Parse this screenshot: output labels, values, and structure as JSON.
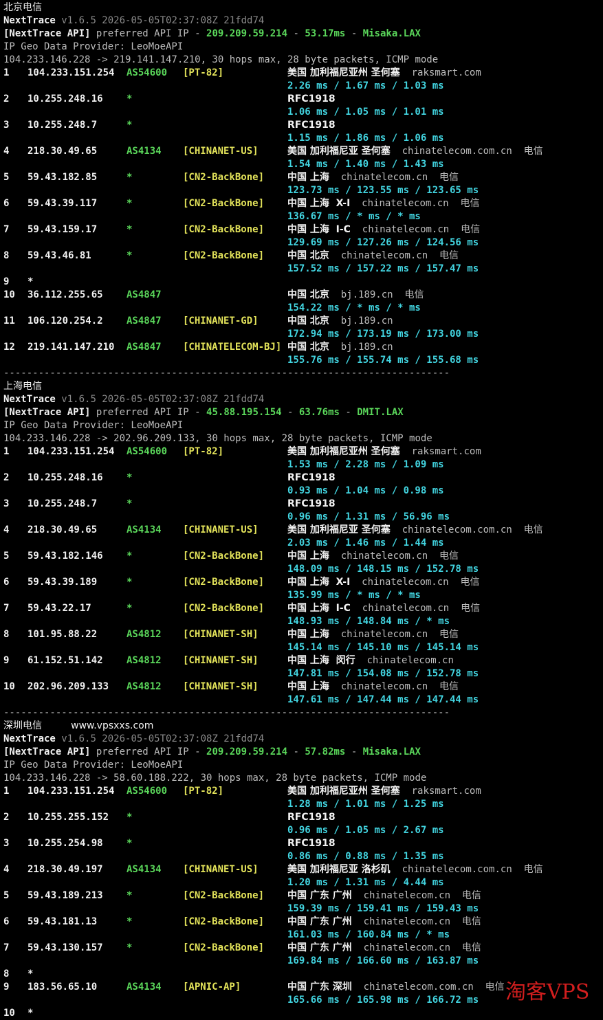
{
  "sections": [
    {
      "title": "北京电信",
      "site_label": "",
      "header": {
        "app": "NextTrace",
        "version": "v1.6.5 2026-05-05T02:37:08Z 21fdd74",
        "api_prefix": "[NextTrace API]",
        "api_text": "preferred API IP -",
        "api_ip": "209.209.59.214",
        "api_dash": "-",
        "api_latency": "53.17ms",
        "api_dash2": "-",
        "api_node": "Misaka.LAX",
        "geo_provider": "IP Geo Data Provider: LeoMoeAPI",
        "route": "104.233.146.228 -> 219.141.147.210, 30 hops max, 28 byte packets, ICMP mode"
      },
      "hops": [
        {
          "n": "1",
          "ip": "104.233.151.254",
          "asn": "AS54600",
          "tag": "[PT-82]",
          "geo": "美国 加利福尼亚州 圣何塞",
          "dom": "raksmart.com",
          "isp": "",
          "rtt": "2.26 ms / 1.67 ms / 1.03 ms"
        },
        {
          "n": "2",
          "ip": "10.255.248.16",
          "asn": "*",
          "tag": "",
          "geo": "RFC1918",
          "dom": "",
          "isp": "",
          "rtt": "1.06 ms / 1.05 ms / 1.01 ms"
        },
        {
          "n": "3",
          "ip": "10.255.248.7",
          "asn": "*",
          "tag": "",
          "geo": "RFC1918",
          "dom": "",
          "isp": "",
          "rtt": "1.15 ms / 1.86 ms / 1.06 ms"
        },
        {
          "n": "4",
          "ip": "218.30.49.65",
          "asn": "AS4134",
          "tag": "[CHINANET-US]",
          "geo": "美国 加利福尼亚 圣何塞",
          "dom": "chinatelecom.com.cn",
          "isp": "电信",
          "rtt": "1.54 ms / 1.40 ms / 1.43 ms"
        },
        {
          "n": "5",
          "ip": "59.43.182.85",
          "asn": "*",
          "tag": "[CN2-BackBone]",
          "geo": "中国 上海",
          "dom": "chinatelecom.cn",
          "isp": "电信",
          "rtt": "123.73 ms / 123.55 ms / 123.65 ms"
        },
        {
          "n": "6",
          "ip": "59.43.39.117",
          "asn": "*",
          "tag": "[CN2-BackBone]",
          "geo": "中国 上海  X-I",
          "dom": "chinatelecom.cn",
          "isp": "电信",
          "rtt": "136.67 ms / * ms / * ms"
        },
        {
          "n": "7",
          "ip": "59.43.159.17",
          "asn": "*",
          "tag": "[CN2-BackBone]",
          "geo": "中国 上海  I-C",
          "dom": "chinatelecom.cn",
          "isp": "电信",
          "rtt": "129.69 ms / 127.26 ms / 124.56 ms"
        },
        {
          "n": "8",
          "ip": "59.43.46.81",
          "asn": "*",
          "tag": "[CN2-BackBone]",
          "geo": "中国 北京",
          "dom": "chinatelecom.cn",
          "isp": "电信",
          "rtt": "157.52 ms / 157.22 ms / 157.47 ms"
        },
        {
          "n": "9",
          "ip": "*",
          "asn": "",
          "tag": "",
          "geo": "",
          "dom": "",
          "isp": "",
          "rtt": ""
        },
        {
          "n": "10",
          "ip": "36.112.255.65",
          "asn": "AS4847",
          "tag": "",
          "geo": "中国 北京",
          "dom": "bj.189.cn",
          "isp": "电信",
          "rtt": "154.22 ms / * ms / * ms"
        },
        {
          "n": "11",
          "ip": "106.120.254.2",
          "asn": "AS4847",
          "tag": "[CHINANET-GD]",
          "geo": "中国 北京",
          "dom": "bj.189.cn",
          "isp": "",
          "rtt": "172.94 ms / 173.19 ms / 173.00 ms"
        },
        {
          "n": "12",
          "ip": "219.141.147.210",
          "asn": "AS4847",
          "tag": "[CHINATELECOM-BJ]",
          "geo": "中国 北京",
          "dom": "bj.189.cn",
          "isp": "",
          "rtt": "155.76 ms / 155.74 ms / 155.68 ms"
        }
      ]
    },
    {
      "title": "上海电信",
      "site_label": "",
      "header": {
        "app": "NextTrace",
        "version": "v1.6.5 2026-05-05T02:37:08Z 21fdd74",
        "api_prefix": "[NextTrace API]",
        "api_text": "preferred API IP -",
        "api_ip": "45.88.195.154",
        "api_dash": "-",
        "api_latency": "63.76ms",
        "api_dash2": "-",
        "api_node": "DMIT.LAX",
        "geo_provider": "IP Geo Data Provider: LeoMoeAPI",
        "route": "104.233.146.228 -> 202.96.209.133, 30 hops max, 28 byte packets, ICMP mode"
      },
      "hops": [
        {
          "n": "1",
          "ip": "104.233.151.254",
          "asn": "AS54600",
          "tag": "[PT-82]",
          "geo": "美国 加利福尼亚州 圣何塞",
          "dom": "raksmart.com",
          "isp": "",
          "rtt": "1.53 ms / 2.28 ms / 1.09 ms"
        },
        {
          "n": "2",
          "ip": "10.255.248.16",
          "asn": "*",
          "tag": "",
          "geo": "RFC1918",
          "dom": "",
          "isp": "",
          "rtt": "0.93 ms / 1.04 ms / 0.98 ms"
        },
        {
          "n": "3",
          "ip": "10.255.248.7",
          "asn": "*",
          "tag": "",
          "geo": "RFC1918",
          "dom": "",
          "isp": "",
          "rtt": "0.96 ms / 1.31 ms / 56.96 ms"
        },
        {
          "n": "4",
          "ip": "218.30.49.65",
          "asn": "AS4134",
          "tag": "[CHINANET-US]",
          "geo": "美国 加利福尼亚 圣何塞",
          "dom": "chinatelecom.com.cn",
          "isp": "电信",
          "rtt": "2.03 ms / 1.46 ms / 1.44 ms"
        },
        {
          "n": "5",
          "ip": "59.43.182.146",
          "asn": "*",
          "tag": "[CN2-BackBone]",
          "geo": "中国 上海",
          "dom": "chinatelecom.cn",
          "isp": "电信",
          "rtt": "148.09 ms / 148.15 ms / 152.78 ms"
        },
        {
          "n": "6",
          "ip": "59.43.39.189",
          "asn": "*",
          "tag": "[CN2-BackBone]",
          "geo": "中国 上海  X-I",
          "dom": "chinatelecom.cn",
          "isp": "电信",
          "rtt": "135.99 ms / * ms / * ms"
        },
        {
          "n": "7",
          "ip": "59.43.22.17",
          "asn": "*",
          "tag": "[CN2-BackBone]",
          "geo": "中国 上海  I-C",
          "dom": "chinatelecom.cn",
          "isp": "电信",
          "rtt": "148.93 ms / 148.84 ms / * ms"
        },
        {
          "n": "8",
          "ip": "101.95.88.22",
          "asn": "AS4812",
          "tag": "[CHINANET-SH]",
          "geo": "中国 上海",
          "dom": "chinatelecom.cn",
          "isp": "电信",
          "rtt": "145.14 ms / 145.10 ms / 145.14 ms"
        },
        {
          "n": "9",
          "ip": "61.152.51.142",
          "asn": "AS4812",
          "tag": "[CHINANET-SH]",
          "geo": "中国 上海  闵行",
          "dom": "chinatelecom.cn",
          "isp": "",
          "rtt": "147.81 ms / 154.08 ms / 152.78 ms"
        },
        {
          "n": "10",
          "ip": "202.96.209.133",
          "asn": "AS4812",
          "tag": "[CHINANET-SH]",
          "geo": "中国 上海",
          "dom": "chinatelecom.cn",
          "isp": "电信",
          "rtt": "147.61 ms / 147.44 ms / 147.44 ms"
        }
      ]
    },
    {
      "title": "深圳电信",
      "site_label": "www.vpsxxs.com",
      "header": {
        "app": "NextTrace",
        "version": "v1.6.5 2026-05-05T02:37:08Z 21fdd74",
        "api_prefix": "[NextTrace API]",
        "api_text": "preferred API IP -",
        "api_ip": "209.209.59.214",
        "api_dash": "-",
        "api_latency": "57.82ms",
        "api_dash2": "-",
        "api_node": "Misaka.LAX",
        "geo_provider": "IP Geo Data Provider: LeoMoeAPI",
        "route": "104.233.146.228 -> 58.60.188.222, 30 hops max, 28 byte packets, ICMP mode"
      },
      "hops": [
        {
          "n": "1",
          "ip": "104.233.151.254",
          "asn": "AS54600",
          "tag": "[PT-82]",
          "geo": "美国 加利福尼亚州 圣何塞",
          "dom": "raksmart.com",
          "isp": "",
          "rtt": "1.28 ms / 1.01 ms / 1.25 ms"
        },
        {
          "n": "2",
          "ip": "10.255.255.152",
          "asn": "*",
          "tag": "",
          "geo": "RFC1918",
          "dom": "",
          "isp": "",
          "rtt": "0.96 ms / 1.05 ms / 2.67 ms"
        },
        {
          "n": "3",
          "ip": "10.255.254.98",
          "asn": "*",
          "tag": "",
          "geo": "RFC1918",
          "dom": "",
          "isp": "",
          "rtt": "0.86 ms / 0.88 ms / 1.35 ms"
        },
        {
          "n": "4",
          "ip": "218.30.49.197",
          "asn": "AS4134",
          "tag": "[CHINANET-US]",
          "geo": "美国 加利福尼亚 洛杉矶",
          "dom": "chinatelecom.com.cn",
          "isp": "电信",
          "rtt": "1.20 ms / 1.31 ms / 4.44 ms"
        },
        {
          "n": "5",
          "ip": "59.43.189.213",
          "asn": "*",
          "tag": "[CN2-BackBone]",
          "geo": "中国 广东 广州",
          "dom": "chinatelecom.cn",
          "isp": "电信",
          "rtt": "159.39 ms / 159.41 ms / 159.43 ms"
        },
        {
          "n": "6",
          "ip": "59.43.181.13",
          "asn": "*",
          "tag": "[CN2-BackBone]",
          "geo": "中国 广东 广州",
          "dom": "chinatelecom.cn",
          "isp": "电信",
          "rtt": "161.03 ms / 160.84 ms / * ms"
        },
        {
          "n": "7",
          "ip": "59.43.130.157",
          "asn": "*",
          "tag": "[CN2-BackBone]",
          "geo": "中国 广东 广州",
          "dom": "chinatelecom.cn",
          "isp": "电信",
          "rtt": "169.84 ms / 166.60 ms / 163.87 ms"
        },
        {
          "n": "8",
          "ip": "*",
          "asn": "",
          "tag": "",
          "geo": "",
          "dom": "",
          "isp": "",
          "rtt": ""
        },
        {
          "n": "9",
          "ip": "183.56.65.10",
          "asn": "AS4134",
          "tag": "[APNIC-AP]",
          "geo": "中国 广东 深圳",
          "dom": "chinatelecom.com.cn",
          "isp": "电信",
          "rtt": "165.66 ms / 165.98 ms / 166.72 ms"
        },
        {
          "n": "10",
          "ip": "*",
          "asn": "",
          "tag": "",
          "geo": "",
          "dom": "",
          "isp": "",
          "rtt": ""
        }
      ]
    }
  ],
  "separator": "-----------------------------------------------------------------------------",
  "watermark": "淘客VPS",
  "colors": {
    "background": "#000000",
    "text": "#d0d0d0",
    "asn": "#5ad65a",
    "tag": "#e3e35a",
    "rtt": "#42d4e0",
    "version": "#8a8a8a",
    "watermark": "#d21e1e"
  }
}
